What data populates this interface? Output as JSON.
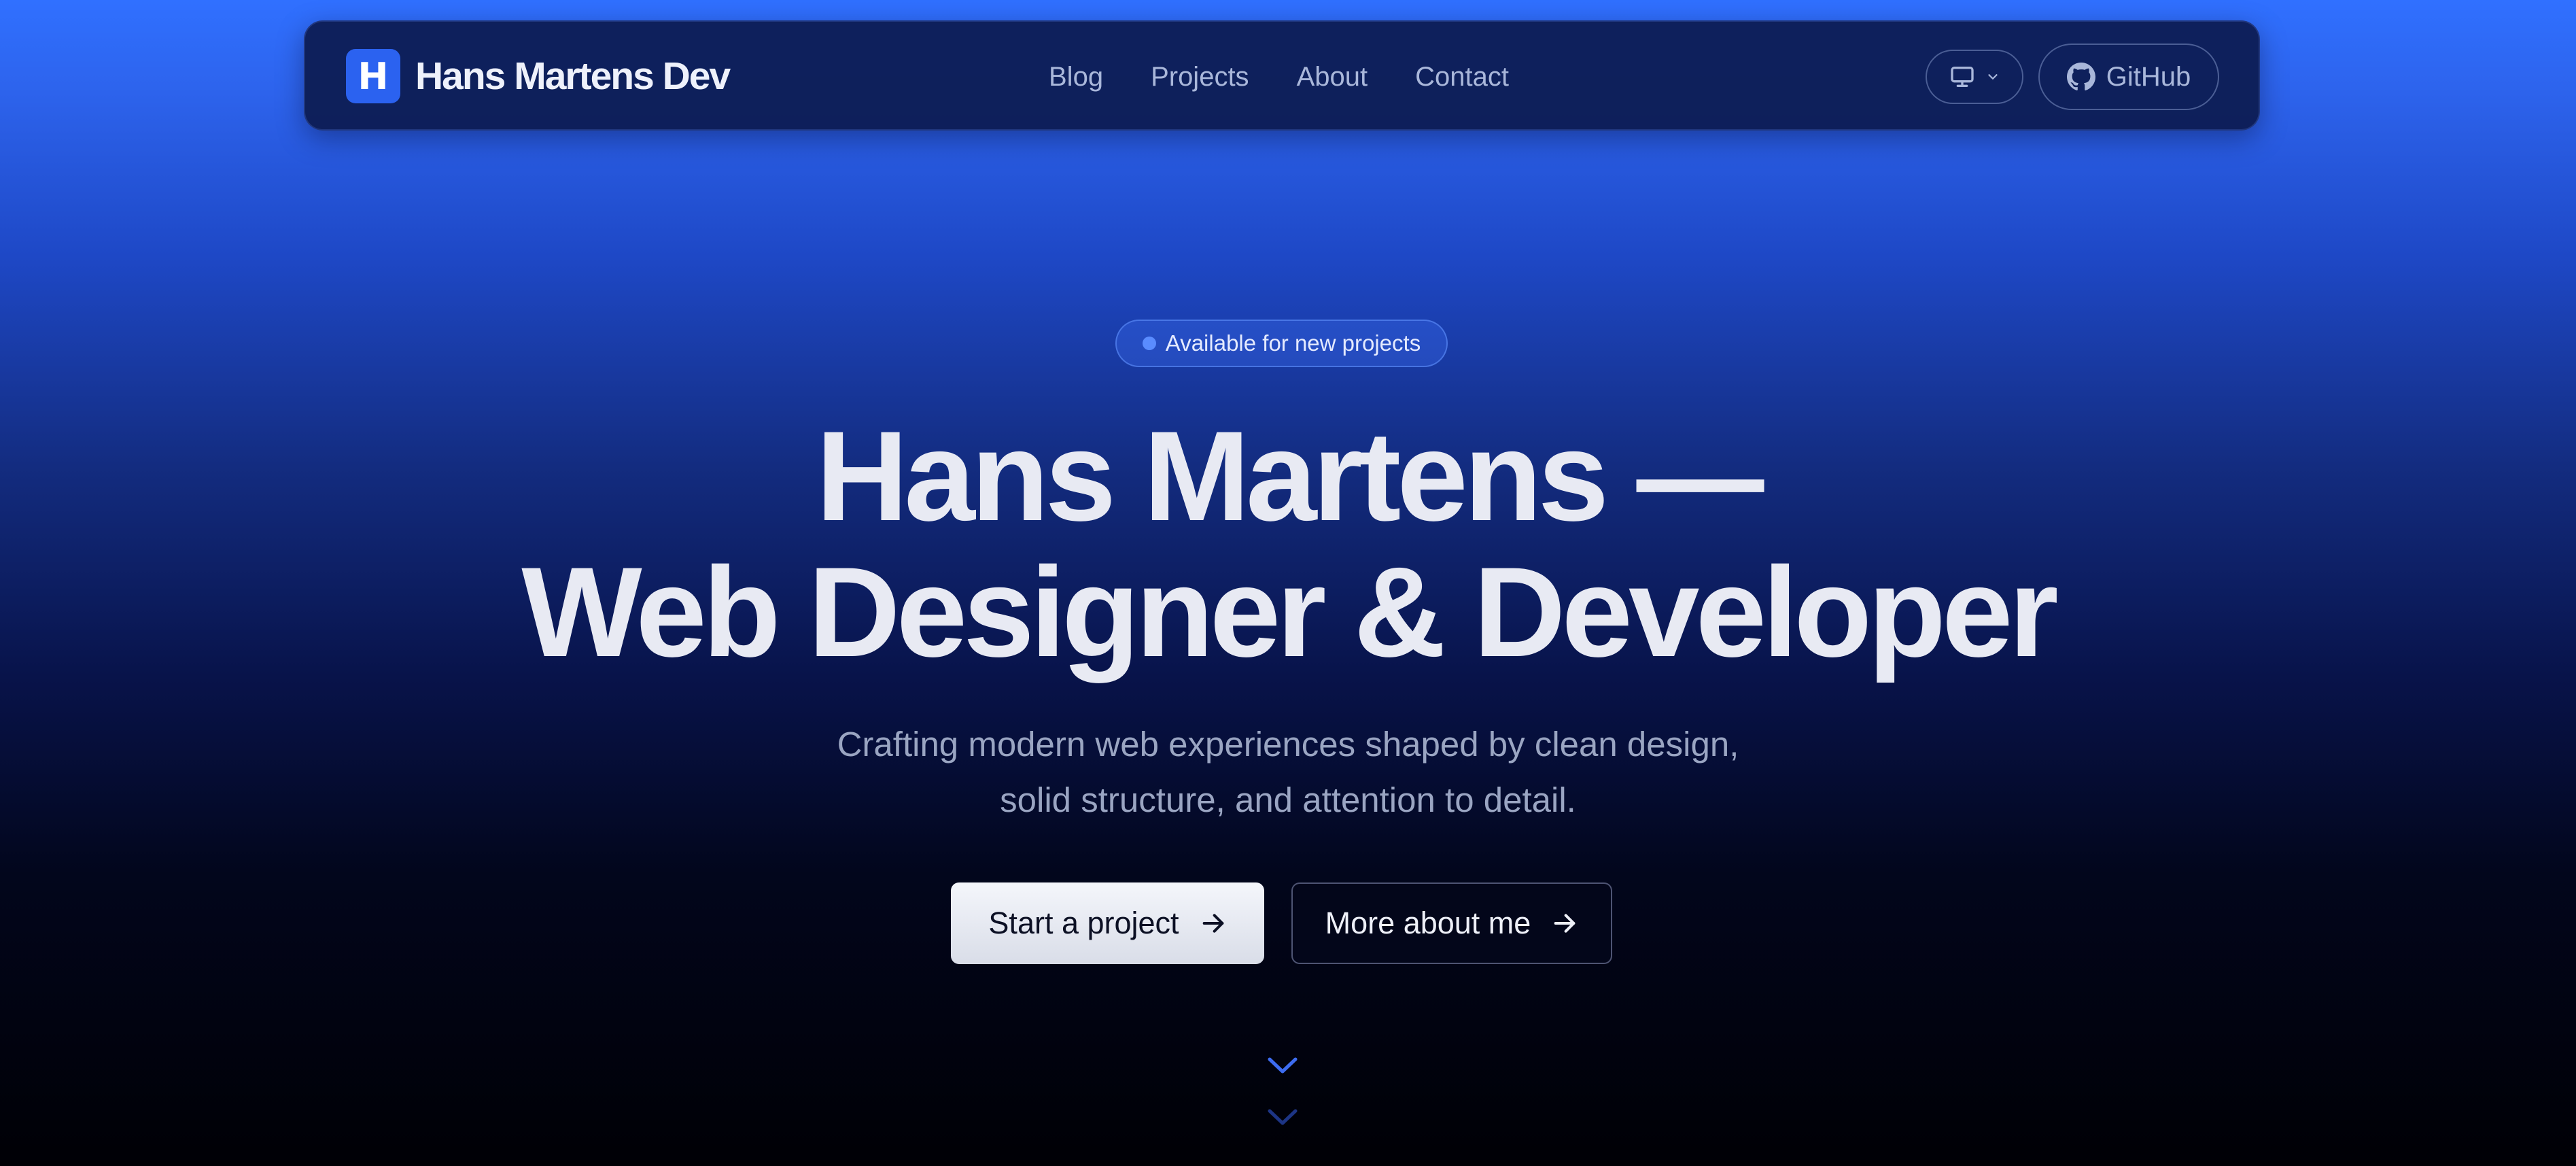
{
  "navbar": {
    "brand_initial": "H",
    "brand_name": "Hans Martens Dev",
    "links": [
      {
        "label": "Blog"
      },
      {
        "label": "Projects"
      },
      {
        "label": "About"
      },
      {
        "label": "Contact"
      }
    ],
    "theme_icon": "monitor-icon",
    "github_label": "GitHub"
  },
  "hero": {
    "badge": "Available for new projects",
    "headline_line1": "Hans Martens —",
    "headline_line2": "Web Designer & Developer",
    "subtitle_line1": "Crafting modern web experiences shaped by clean design,",
    "subtitle_line2": "solid structure, and attention to detail.",
    "primary_cta": "Start a project",
    "secondary_cta": "More about me",
    "scroll_icon": "chevron-double-down-icon"
  },
  "colors": {
    "accent": "#2b62f0",
    "background_top": "#3070ff",
    "background_bottom": "#000005"
  }
}
